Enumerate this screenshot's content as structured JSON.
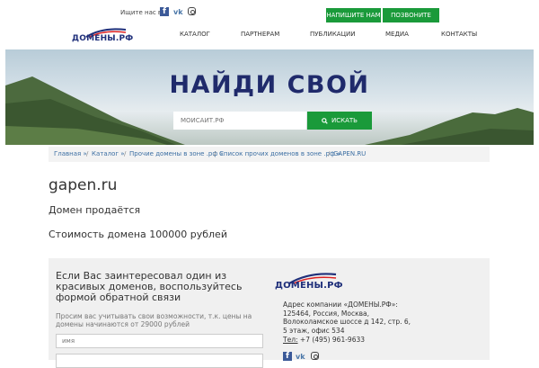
{
  "header": {
    "find_us_label": "Ищите нас в:",
    "social": {
      "fb": "f",
      "vk": "vk"
    },
    "buttons": {
      "write": "НАПИШИТЕ НАМ",
      "call": "ПОЗВОНИТЕ НАМ"
    },
    "logo_text": "ДОМЕНЫ.РФ",
    "nav": [
      "КАТАЛОГ",
      "ПАРТНЕРАМ",
      "ПУБЛИКАЦИИ",
      "МЕДИА",
      "КОНТАКТЫ"
    ]
  },
  "hero": {
    "title": "НАЙДИ СВОЙ",
    "search_placeholder": "МОЙСАЙТ.РФ",
    "search_button": "ИСКАТЬ"
  },
  "breadcrumb": [
    "Главная »",
    "Каталог »",
    "Прочие домены в зоне .рф »",
    "Список прочих доменов в зоне .рф »",
    "GAPEN.RU"
  ],
  "main": {
    "domain": "gapen.ru",
    "status": "Домен продаётся",
    "price": "Стоимость домена 100000 рублей"
  },
  "contact": {
    "title": "Если Вас заинтересовал один из красивых доменов, воспользуйтесь формой обратной связи",
    "note": "Просим вас учитывать свои возможности, т.к. цены на домены начинаются от 29000 рублей",
    "name_placeholder": "имя",
    "logo_text": "ДОМЕНЫ.РФ",
    "address_lines": [
      "Адрес компании «ДОМЕНЫ.РФ»:",
      "125464, Россия, Москва,",
      "Волоколамское шоссе д 142, стр. 6,",
      "5 этаж, офис 534"
    ],
    "phone_label": "Тел:",
    "phone": "+7 (495) 961-9633"
  },
  "colors": {
    "accent_green": "#1a9a3a",
    "brand_navy": "#1f2a6b",
    "link_blue": "#3c6fa3"
  }
}
